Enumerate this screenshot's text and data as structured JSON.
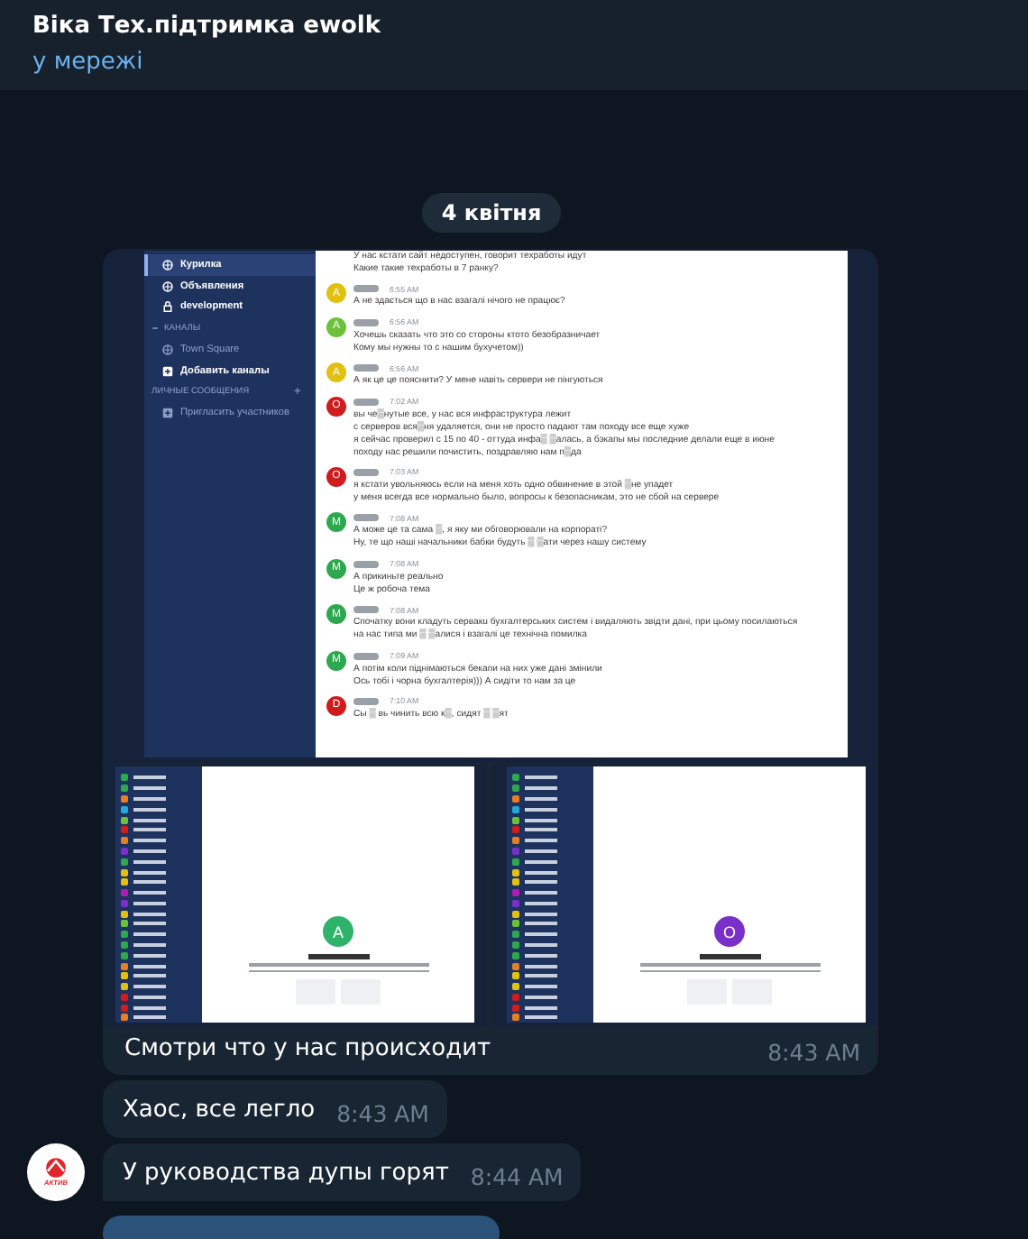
{
  "header": {
    "title": "Віка Тех.підтримка ewolk",
    "status": "у мережі"
  },
  "date_pill": "4 квітня",
  "album": {
    "screenshot_main": {
      "sidebar": [
        {
          "kind": "channel",
          "label": "Курилка",
          "selected": true,
          "unread": true
        },
        {
          "kind": "channel",
          "label": "Объявления",
          "selected": false,
          "unread": true
        },
        {
          "kind": "private_channel",
          "label": "development",
          "selected": false,
          "unread": true
        },
        {
          "kind": "section",
          "label": "КАНАЛЫ"
        },
        {
          "kind": "channel",
          "label": "Town Square",
          "selected": false,
          "unread": false
        },
        {
          "kind": "action",
          "label": "Добавить каналы",
          "unread": true
        },
        {
          "kind": "section",
          "label": "ЛИЧНЫЕ СООБЩЕНИЯ",
          "add": "+"
        },
        {
          "kind": "action",
          "label": "Пригласить участников",
          "unread": false
        }
      ],
      "messages": [
        {
          "kind": "continuation",
          "lines": [
            "У нас кстати сайт недоступен, говорит техработы идут",
            "Какие такие техработы в 7 ранку?"
          ]
        },
        {
          "kind": "head",
          "avatar": "A",
          "color": "#e2c010",
          "time": "6:55 AM",
          "lines": [
            "А не здається що в нас взагалі нічого не працює?"
          ]
        },
        {
          "kind": "head",
          "avatar": "A",
          "color": "#6cc13a",
          "time": "6:56 AM",
          "lines": [
            "Хочешь сказать что это со стороны ктото безобразничает",
            "Кому мы нужны то с нашим бухучетом))"
          ]
        },
        {
          "kind": "head",
          "avatar": "A",
          "color": "#e2c010",
          "time": "6:56 AM",
          "lines": [
            "А як це це пояснити? У мене навіть сервери не пінгуються"
          ]
        },
        {
          "kind": "head",
          "avatar": "O",
          "color": "#d01c1c",
          "time": "7:02 AM",
          "lines": [
            "вы че▒нутые все, у нас вся инфраструктура лежит",
            "с серверов вся▒ня удаляется, они не просто падают там походу все еще хуже",
            "я сейчас проверил с 15 по 40 - оттуда инфа▒ ▒алась, а бэкапы мы последние делали еще в июне",
            "походу нас решили почистить, поздравляю нам п▒да"
          ]
        },
        {
          "kind": "head",
          "avatar": "O",
          "color": "#d01c1c",
          "time": "7:03 AM",
          "lines": [
            "я кстати увольняюсь если на меня хоть одно обвинение в этой ▒не упадет",
            "у меня всегда все нормально было, вопросы к безопасникам, это не сбой на сервере"
          ]
        },
        {
          "kind": "head",
          "avatar": "M",
          "color": "#2ea84f",
          "time": "7:08 AM",
          "lines": [
            "А може це та сама ▒, я яку ми обговорювали на корпораті?",
            "Ну, те що наші начальники бабки будуть ▒ ▒ати через нашу систему"
          ]
        },
        {
          "kind": "head",
          "avatar": "M",
          "color": "#2ea84f",
          "time": "7:08 AM",
          "lines": [
            "А прикиньте реально",
            "Це ж робоча тема"
          ]
        },
        {
          "kind": "head",
          "avatar": "M",
          "color": "#2ea84f",
          "time": "7:08 AM",
          "lines": [
            "Спочатку вони кладуть сервакu бухгалтерських систем і видаляють звідти дані, при цьому посилаються",
            "на нас типа ми ▒ ▒алися і взагалі це технічна помилка"
          ]
        },
        {
          "kind": "head",
          "avatar": "M",
          "color": "#2ea84f",
          "time": "7:09 AM",
          "lines": [
            "А потім коли піднімаються бекапи на них уже дані змінили",
            "Ось тобі і чорна бухгалтерія))) А сидіти то нам за це"
          ]
        },
        {
          "kind": "head",
          "avatar": "D",
          "color": "#d01c1c",
          "time": "7:10 AM",
          "lines": [
            "Сы ▒ вь чинить всю к▒, сидят ▒ ▒ят"
          ]
        }
      ]
    },
    "screenshots": [
      {
        "avatar": "A",
        "color": "#2fb36a"
      },
      {
        "avatar": "O",
        "color": "#7b2fc9"
      }
    ],
    "caption": "Смотри что у нас происходит",
    "time": "8:43 AM"
  },
  "messages": [
    {
      "text": "Хаос, все легло",
      "time": "8:43 AM",
      "avatar": false
    },
    {
      "text": "У руководства дупы горят",
      "time": "8:44 AM",
      "avatar": true,
      "avatar_label": "АКТИВ"
    }
  ]
}
